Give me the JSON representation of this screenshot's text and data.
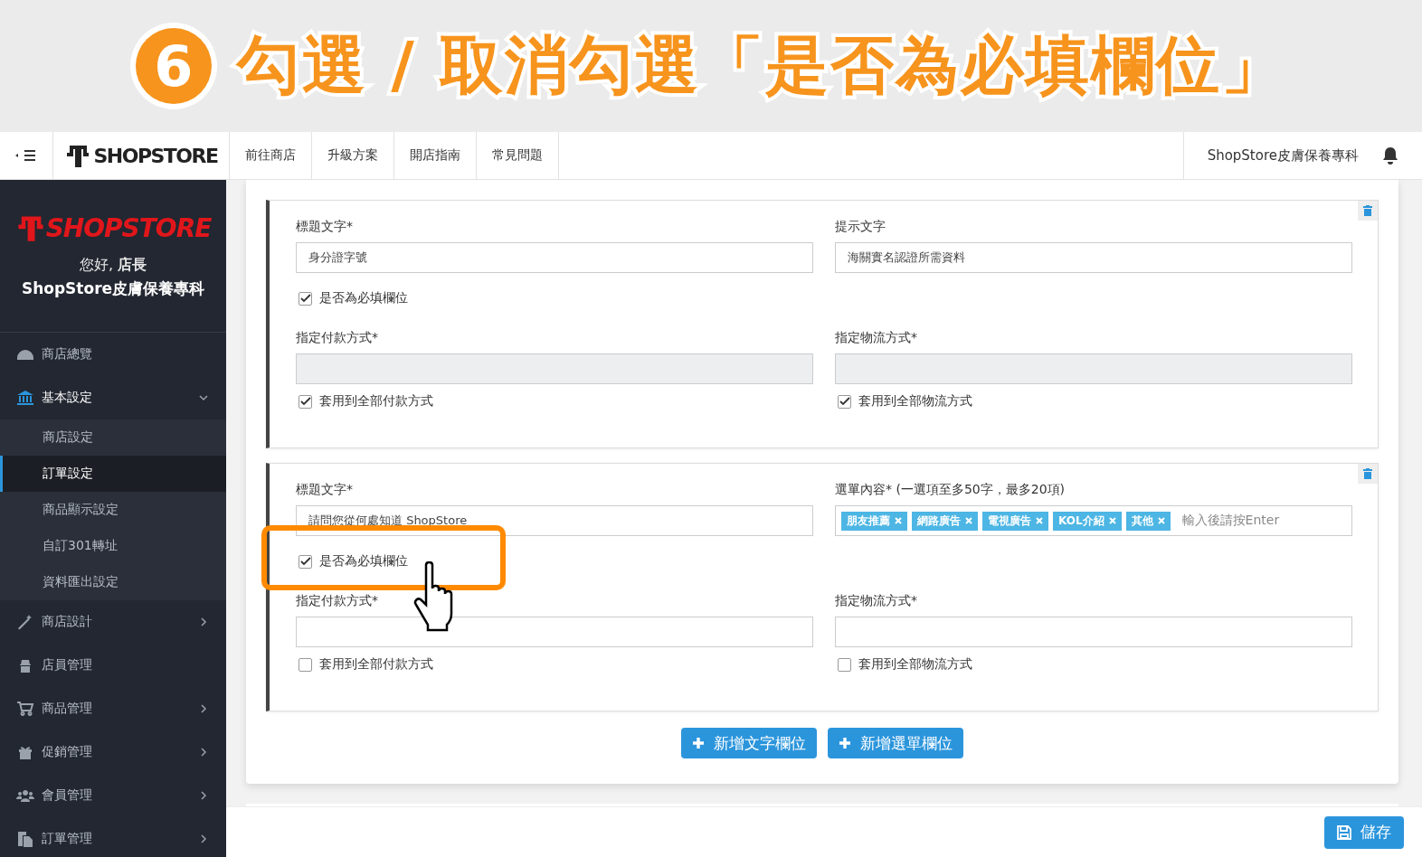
{
  "banner": {
    "step": "6",
    "title": "勾選 / 取消勾選「是否為必填欄位」"
  },
  "topbar": {
    "logo": "SHOPSTORE",
    "nav": [
      "前往商店",
      "升級方案",
      "開店指南",
      "常見問題"
    ],
    "store_name": "ShopStore皮膚保養專科"
  },
  "sidebar": {
    "logo": "SHOPSTORE",
    "greeting": "您好, **店長**",
    "store_name": "ShopStore皮膚保養專科",
    "menu": [
      {
        "label": "商店總覽"
      },
      {
        "label": "基本設定",
        "expanded": true,
        "children": [
          {
            "label": "商店設定",
            "selected": false
          },
          {
            "label": "訂單設定",
            "selected": true
          },
          {
            "label": "商品顯示設定",
            "selected": false
          },
          {
            "label": "自訂301轉址",
            "selected": false
          },
          {
            "label": "資料匯出設定",
            "selected": false
          }
        ]
      },
      {
        "label": "商店設計",
        "expanded": false
      },
      {
        "label": "店員管理"
      },
      {
        "label": "商品管理",
        "expanded": false
      },
      {
        "label": "促銷管理",
        "expanded": false
      },
      {
        "label": "會員管理",
        "expanded": false
      },
      {
        "label": "訂單管理",
        "expanded": false
      }
    ]
  },
  "fields": [
    {
      "kind": "text",
      "title_label": "標題文字*",
      "title_value": "身分證字號",
      "hint_label": "提示文字",
      "hint_value": "海關實名認證所需資料",
      "required": {
        "label": "是否為必填欄位",
        "checked": true
      },
      "payment": {
        "label": "指定付款方式*",
        "apply_all": {
          "label": "套用到全部付款方式",
          "checked": true
        }
      },
      "shipping": {
        "label": "指定物流方式*",
        "apply_all": {
          "label": "套用到全部物流方式",
          "checked": true
        }
      }
    },
    {
      "kind": "select",
      "title_label": "標題文字*",
      "title_value": "請問您從何處知道 ShopStore",
      "options_label": "選單內容* (一選項至多50字，最多20項)",
      "options": [
        "朋友推薦",
        "網路廣告",
        "電視廣告",
        "KOL介紹",
        "其他"
      ],
      "options_placeholder": "輸入後請按Enter",
      "required": {
        "label": "是否為必填欄位",
        "checked": true,
        "highlighted": true
      },
      "payment": {
        "label": "指定付款方式*",
        "apply_all": {
          "label": "套用到全部付款方式",
          "checked": false
        }
      },
      "shipping": {
        "label": "指定物流方式*",
        "apply_all": {
          "label": "套用到全部物流方式",
          "checked": false
        }
      }
    }
  ],
  "add_buttons": [
    {
      "label": "新增文字欄位"
    },
    {
      "label": "新增選單欄位"
    }
  ],
  "save_button": {
    "label": "儲存"
  }
}
